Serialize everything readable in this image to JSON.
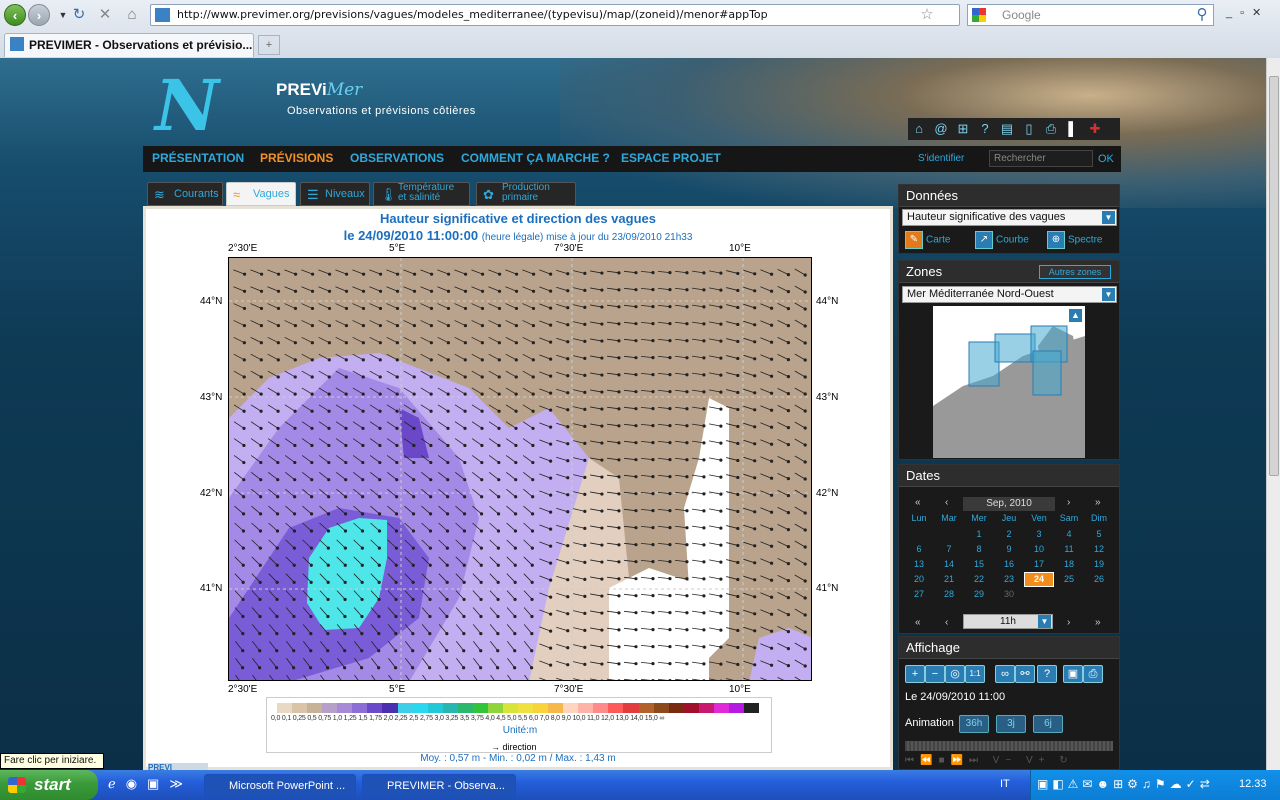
{
  "browser": {
    "url": "http://www.previmer.org/previsions/vagues/modeles_mediterranee/(typevisu)/map/(zoneid)/menor#appTop",
    "search_placeholder": "Google",
    "tab_title": "PREVIMER - Observations et prévisio...",
    "new_tab": "+"
  },
  "site": {
    "brand": "PREVi",
    "brand2": "Mer",
    "tagline": "Observations et prévisions côtières",
    "nav": [
      "PRÉSENTATION",
      "PRÉVISIONS",
      "OBSERVATIONS",
      "COMMENT ÇA MARCHE ?",
      "ESPACE PROJET"
    ],
    "nav_active": "PRÉVISIONS",
    "signin": "S'identifier",
    "search_placeholder": "Rechercher",
    "ok": "OK",
    "subtabs": [
      "Courants",
      "Vagues",
      "Niveaux",
      "Température et salinité",
      "Production primaire"
    ],
    "subtab_active": "Vagues"
  },
  "map": {
    "title": "Hauteur significative et direction des vagues",
    "date": "le 24/09/2010 11:00:00",
    "date_note": "(heure légale) mise à jour du 23/09/2010 21h33",
    "lon_labels": [
      "2°30'E",
      "5°E",
      "7°30'E",
      "10°E"
    ],
    "lat_labels": [
      "44°N",
      "43°N",
      "42°N",
      "41°N"
    ],
    "legend_ticks": "0,0 0,1 0,25 0,5 0,75 1,0 1,25 1,5 1,75 2,0 2,25 2,5 2,75 3,0 3,25 3,5 3,75 4,0 4,5 5,0 5,5 6,0 7,0 8,0 9,0 10,0 11,0 12,0 13,0 14,0 15,0 ∞",
    "unit": "Unité:m",
    "direction": "→ direction",
    "stats": "Moy. : 0,57 m   -   Min. : 0,02 m / Max. : 1,43 m",
    "legend_colors": [
      "#e8d9c4",
      "#d9c4a8",
      "#c8b199",
      "#b5a0c9",
      "#a68ad8",
      "#8d6ed6",
      "#6a4ac8",
      "#4a2fb0",
      "#3bd0e8",
      "#2ad7f0",
      "#20c8d8",
      "#26b8b0",
      "#2bb76d",
      "#32c43a",
      "#8fd43a",
      "#d6e43c",
      "#f0e040",
      "#f6d43a",
      "#f6b84a",
      "#ffd5c0",
      "#ffb3a8",
      "#ff8a8a",
      "#ff5a5a",
      "#e23c3c",
      "#b4602a",
      "#8c4a1a",
      "#7a2a10",
      "#a0102a",
      "#c81870",
      "#e02ad8",
      "#b41ae0",
      "#222"
    ]
  },
  "right": {
    "donnees_title": "Données",
    "donnees_select": "Hauteur significative des vagues",
    "carte": "Carte",
    "courbe": "Courbe",
    "spectre": "Spectre",
    "zones_title": "Zones",
    "autres_zones": "Autres zones",
    "zone_select": "Mer Méditerranée Nord-Ouest",
    "dates_title": "Dates",
    "month": "Sep, 2010",
    "days_header": [
      "Lun",
      "Mar",
      "Mer",
      "Jeu",
      "Ven",
      "Sam",
      "Dim"
    ],
    "days": [
      "",
      "",
      "1",
      "2",
      "3",
      "4",
      "5",
      "6",
      "7",
      "8",
      "9",
      "10",
      "11",
      "12",
      "13",
      "14",
      "15",
      "16",
      "17",
      "18",
      "19",
      "20",
      "21",
      "22",
      "23",
      "24",
      "25",
      "26",
      "27",
      "28",
      "29",
      "30",
      "",
      "",
      ""
    ],
    "selected_day": "24",
    "hour": "11h",
    "affichage_title": "Affichage",
    "datetime": "Le 24/09/2010 11:00",
    "animation_label": "Animation",
    "anim_buttons": [
      "36h",
      "3j",
      "6j"
    ]
  },
  "taskbar": {
    "start": "start",
    "tooltip": "Fare clic per iniziare.",
    "items": [
      "Microsoft PowerPoint ...",
      "PREVIMER - Observa..."
    ],
    "lang": "IT",
    "time": "12.33"
  }
}
